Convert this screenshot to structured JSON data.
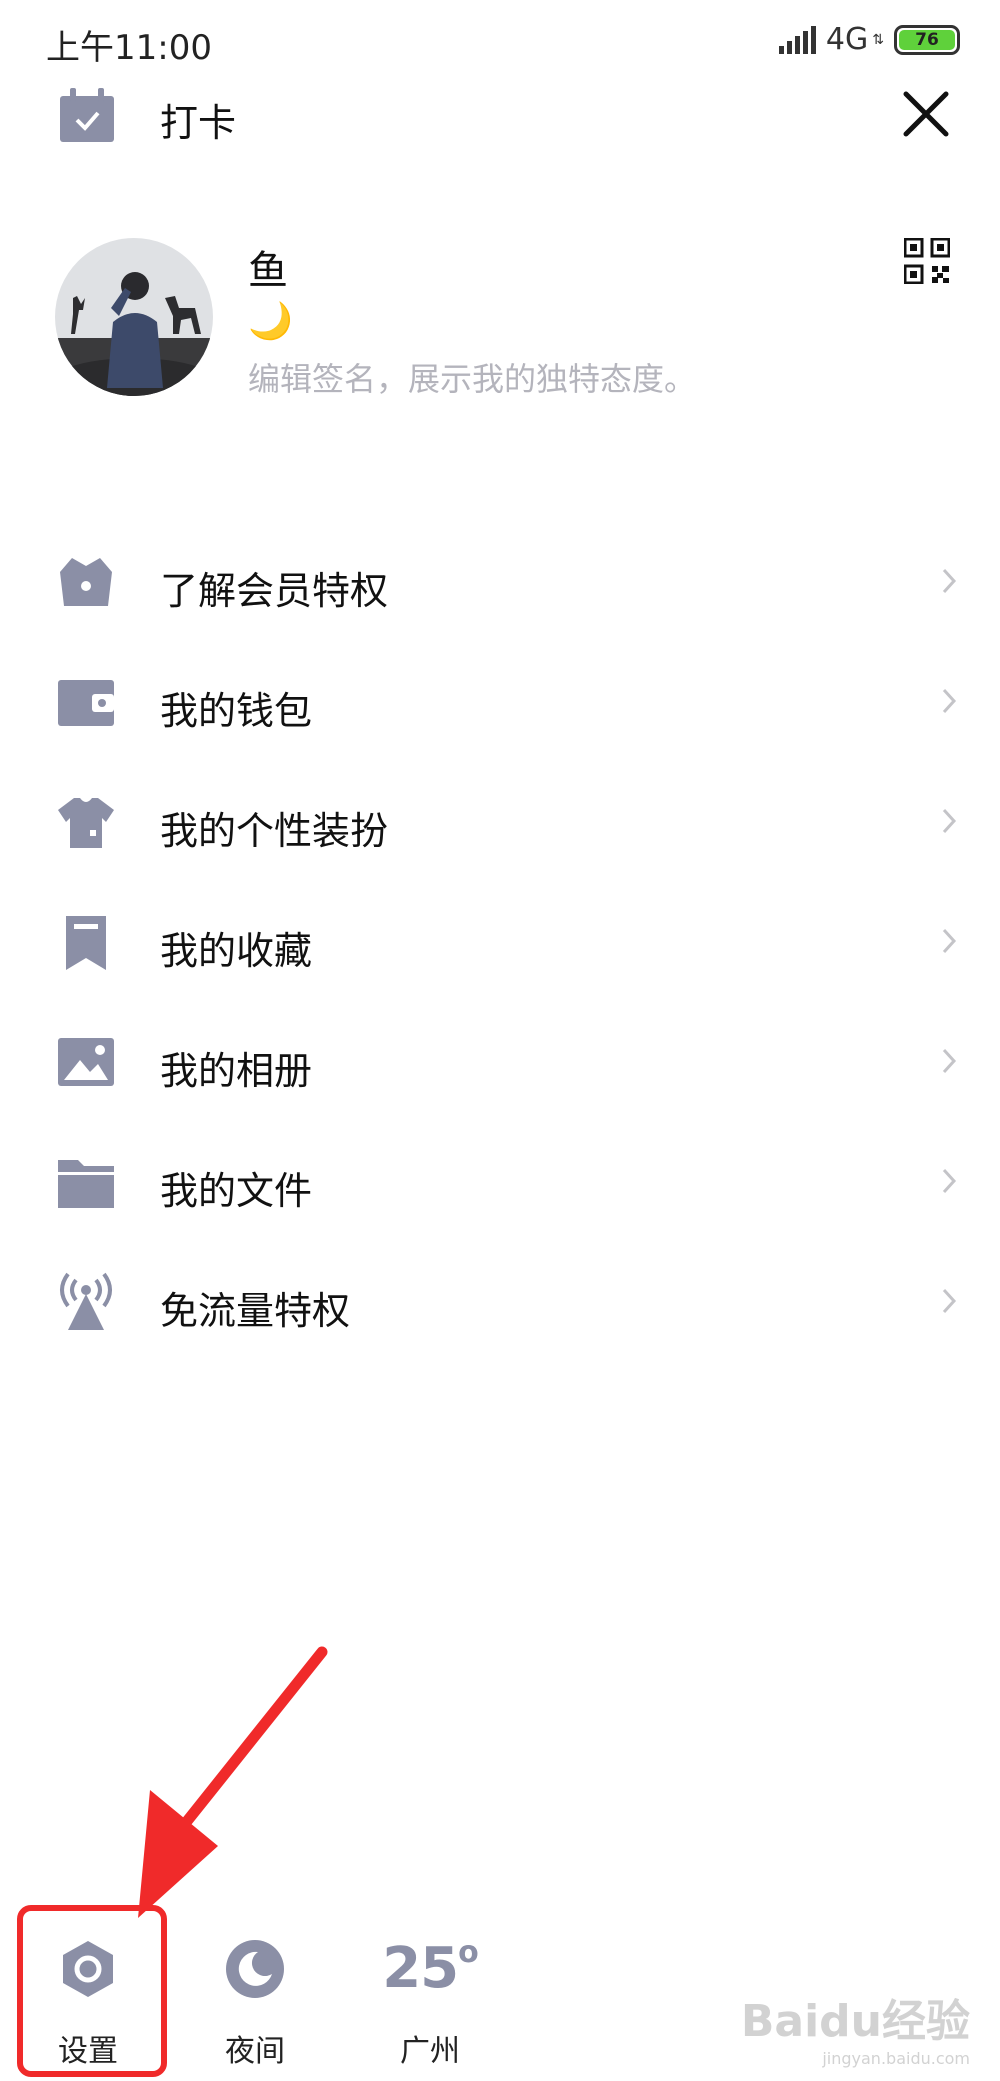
{
  "status_bar": {
    "time": "上午11:00",
    "network": "4G",
    "battery": "76"
  },
  "topbar": {
    "checkin_label": "打卡"
  },
  "profile": {
    "nickname": "鱼",
    "status_emoji": "🌙",
    "signature_placeholder": "编辑签名，展示我的独特态度。"
  },
  "menu": {
    "items": [
      {
        "label": "了解会员特权",
        "icon": "crown-icon"
      },
      {
        "label": "我的钱包",
        "icon": "wallet-icon"
      },
      {
        "label": "我的个性装扮",
        "icon": "shirt-icon"
      },
      {
        "label": "我的收藏",
        "icon": "bookmark-icon"
      },
      {
        "label": "我的相册",
        "icon": "photo-icon"
      },
      {
        "label": "我的文件",
        "icon": "folder-icon"
      },
      {
        "label": "免流量特权",
        "icon": "signal-tower-icon"
      }
    ]
  },
  "bottom_bar": {
    "settings_label": "设置",
    "night_label": "夜间",
    "weather_temp": "25",
    "weather_city": "广州"
  },
  "watermark": {
    "main": "Baidu经验",
    "sub": "jingyan.baidu.com"
  },
  "colors": {
    "icon_gray": "#8b8fa6",
    "highlight_red": "#f02a2a",
    "battery_green": "#5fd13b"
  }
}
